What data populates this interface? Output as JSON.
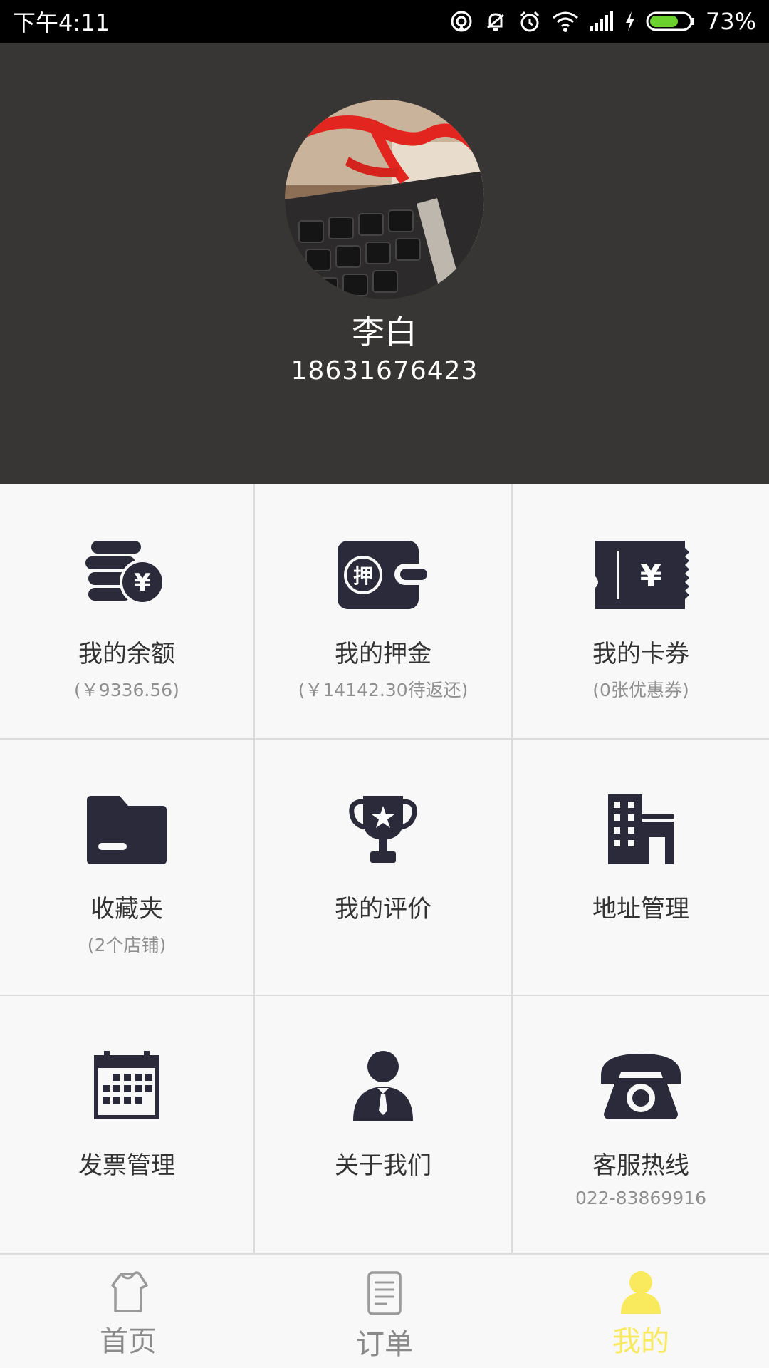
{
  "status_bar": {
    "time": "下午4:11",
    "battery": "73%",
    "battery_level": 0.73
  },
  "profile": {
    "name": "李白",
    "phone": "18631676423"
  },
  "menu": [
    {
      "label": "我的余额",
      "sub": "(￥9336.56)",
      "icon": "coins-yen-icon"
    },
    {
      "label": "我的押金",
      "sub": "(￥14142.30待返还)",
      "icon": "wallet-deposit-icon",
      "icon_text": "押"
    },
    {
      "label": "我的卡券",
      "sub": "(0张优惠券)",
      "icon": "ticket-icon"
    },
    {
      "label": "收藏夹",
      "sub": "(2个店铺)",
      "icon": "folder-icon"
    },
    {
      "label": "我的评价",
      "sub": "",
      "icon": "trophy-icon"
    },
    {
      "label": "地址管理",
      "sub": "",
      "icon": "building-icon"
    },
    {
      "label": "发票管理",
      "sub": "",
      "icon": "calendar-icon"
    },
    {
      "label": "关于我们",
      "sub": "",
      "icon": "person-suit-icon"
    },
    {
      "label": "客服热线",
      "sub": "022-83869916",
      "icon": "telephone-icon"
    }
  ],
  "bottom_nav": [
    {
      "label": "首页",
      "icon": "home-icon"
    },
    {
      "label": "订单",
      "icon": "order-list-icon"
    },
    {
      "label": "我的",
      "icon": "profile-icon",
      "active": true
    }
  ],
  "colors": {
    "header_bg": "#383635",
    "icon_dark": "#2b2a3a",
    "active_yellow": "#f8ea5c",
    "inactive_gray": "#8a8a8a"
  }
}
